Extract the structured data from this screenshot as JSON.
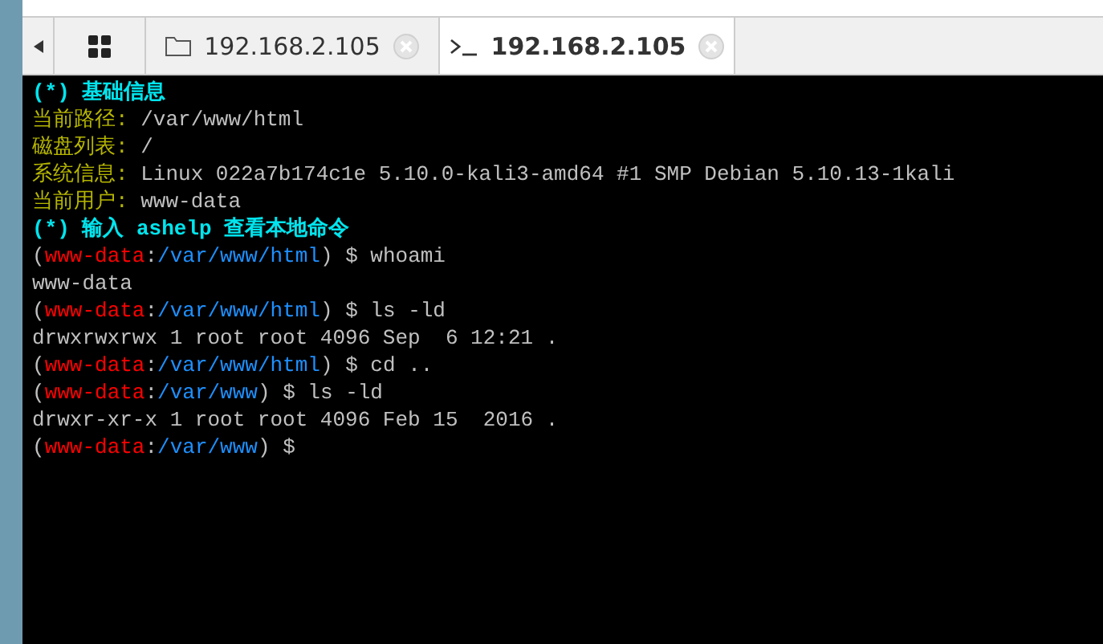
{
  "tabs": [
    {
      "kind": "home",
      "selected": false
    },
    {
      "kind": "files",
      "label": "192.168.2.105",
      "selected": false
    },
    {
      "kind": "terminal",
      "label": "192.168.2.105",
      "selected": true
    }
  ],
  "terminal": {
    "lines": [
      {
        "kind": "heading",
        "segments": [
          {
            "text": "(*) 基础信息",
            "color": "#00e5ee"
          }
        ]
      },
      {
        "kind": "info",
        "segments": [
          {
            "text": "当前路径: ",
            "color": "#b5b500"
          },
          {
            "text": "/var/www/html",
            "color": "#c0c0c0"
          }
        ]
      },
      {
        "kind": "info",
        "segments": [
          {
            "text": "磁盘列表: ",
            "color": "#b5b500"
          },
          {
            "text": "/",
            "color": "#c0c0c0"
          }
        ]
      },
      {
        "kind": "info",
        "segments": [
          {
            "text": "系统信息: ",
            "color": "#b5b500"
          },
          {
            "text": "Linux 022a7b174c1e 5.10.0-kali3-amd64 #1 SMP Debian 5.10.13-1kali",
            "color": "#c0c0c0"
          }
        ]
      },
      {
        "kind": "info",
        "segments": [
          {
            "text": "当前用户: ",
            "color": "#b5b500"
          },
          {
            "text": "www-data",
            "color": "#c0c0c0"
          }
        ]
      },
      {
        "kind": "heading",
        "segments": [
          {
            "text": "(*) 输入 ashelp 查看本地命令",
            "color": "#00e5ee"
          }
        ]
      },
      {
        "kind": "prompt",
        "segments": [
          {
            "text": "(",
            "color": "#c0c0c0"
          },
          {
            "text": "www-data",
            "color": "#ff0000"
          },
          {
            "text": ":",
            "color": "#c0c0c0"
          },
          {
            "text": "/var/www/html",
            "color": "#1e90ff"
          },
          {
            "text": ") $ whoami",
            "color": "#c0c0c0"
          }
        ]
      },
      {
        "kind": "output",
        "segments": [
          {
            "text": "www-data",
            "color": "#c0c0c0"
          }
        ]
      },
      {
        "kind": "prompt",
        "segments": [
          {
            "text": "(",
            "color": "#c0c0c0"
          },
          {
            "text": "www-data",
            "color": "#ff0000"
          },
          {
            "text": ":",
            "color": "#c0c0c0"
          },
          {
            "text": "/var/www/html",
            "color": "#1e90ff"
          },
          {
            "text": ") $ ls -ld",
            "color": "#c0c0c0"
          }
        ]
      },
      {
        "kind": "output",
        "segments": [
          {
            "text": "drwxrwxrwx 1 root root 4096 Sep  6 12:21 .",
            "color": "#c0c0c0"
          }
        ]
      },
      {
        "kind": "prompt",
        "segments": [
          {
            "text": "(",
            "color": "#c0c0c0"
          },
          {
            "text": "www-data",
            "color": "#ff0000"
          },
          {
            "text": ":",
            "color": "#c0c0c0"
          },
          {
            "text": "/var/www/html",
            "color": "#1e90ff"
          },
          {
            "text": ") $ cd ..",
            "color": "#c0c0c0"
          }
        ]
      },
      {
        "kind": "prompt",
        "segments": [
          {
            "text": "(",
            "color": "#c0c0c0"
          },
          {
            "text": "www-data",
            "color": "#ff0000"
          },
          {
            "text": ":",
            "color": "#c0c0c0"
          },
          {
            "text": "/var/www",
            "color": "#1e90ff"
          },
          {
            "text": ") $ ls -ld",
            "color": "#c0c0c0"
          }
        ]
      },
      {
        "kind": "output",
        "segments": [
          {
            "text": "drwxr-xr-x 1 root root 4096 Feb 15  2016 .",
            "color": "#c0c0c0"
          }
        ]
      },
      {
        "kind": "prompt",
        "segments": [
          {
            "text": "(",
            "color": "#c0c0c0"
          },
          {
            "text": "www-data",
            "color": "#ff0000"
          },
          {
            "text": ":",
            "color": "#c0c0c0"
          },
          {
            "text": "/var/www",
            "color": "#1e90ff"
          },
          {
            "text": ") $",
            "color": "#c0c0c0"
          }
        ]
      }
    ]
  }
}
